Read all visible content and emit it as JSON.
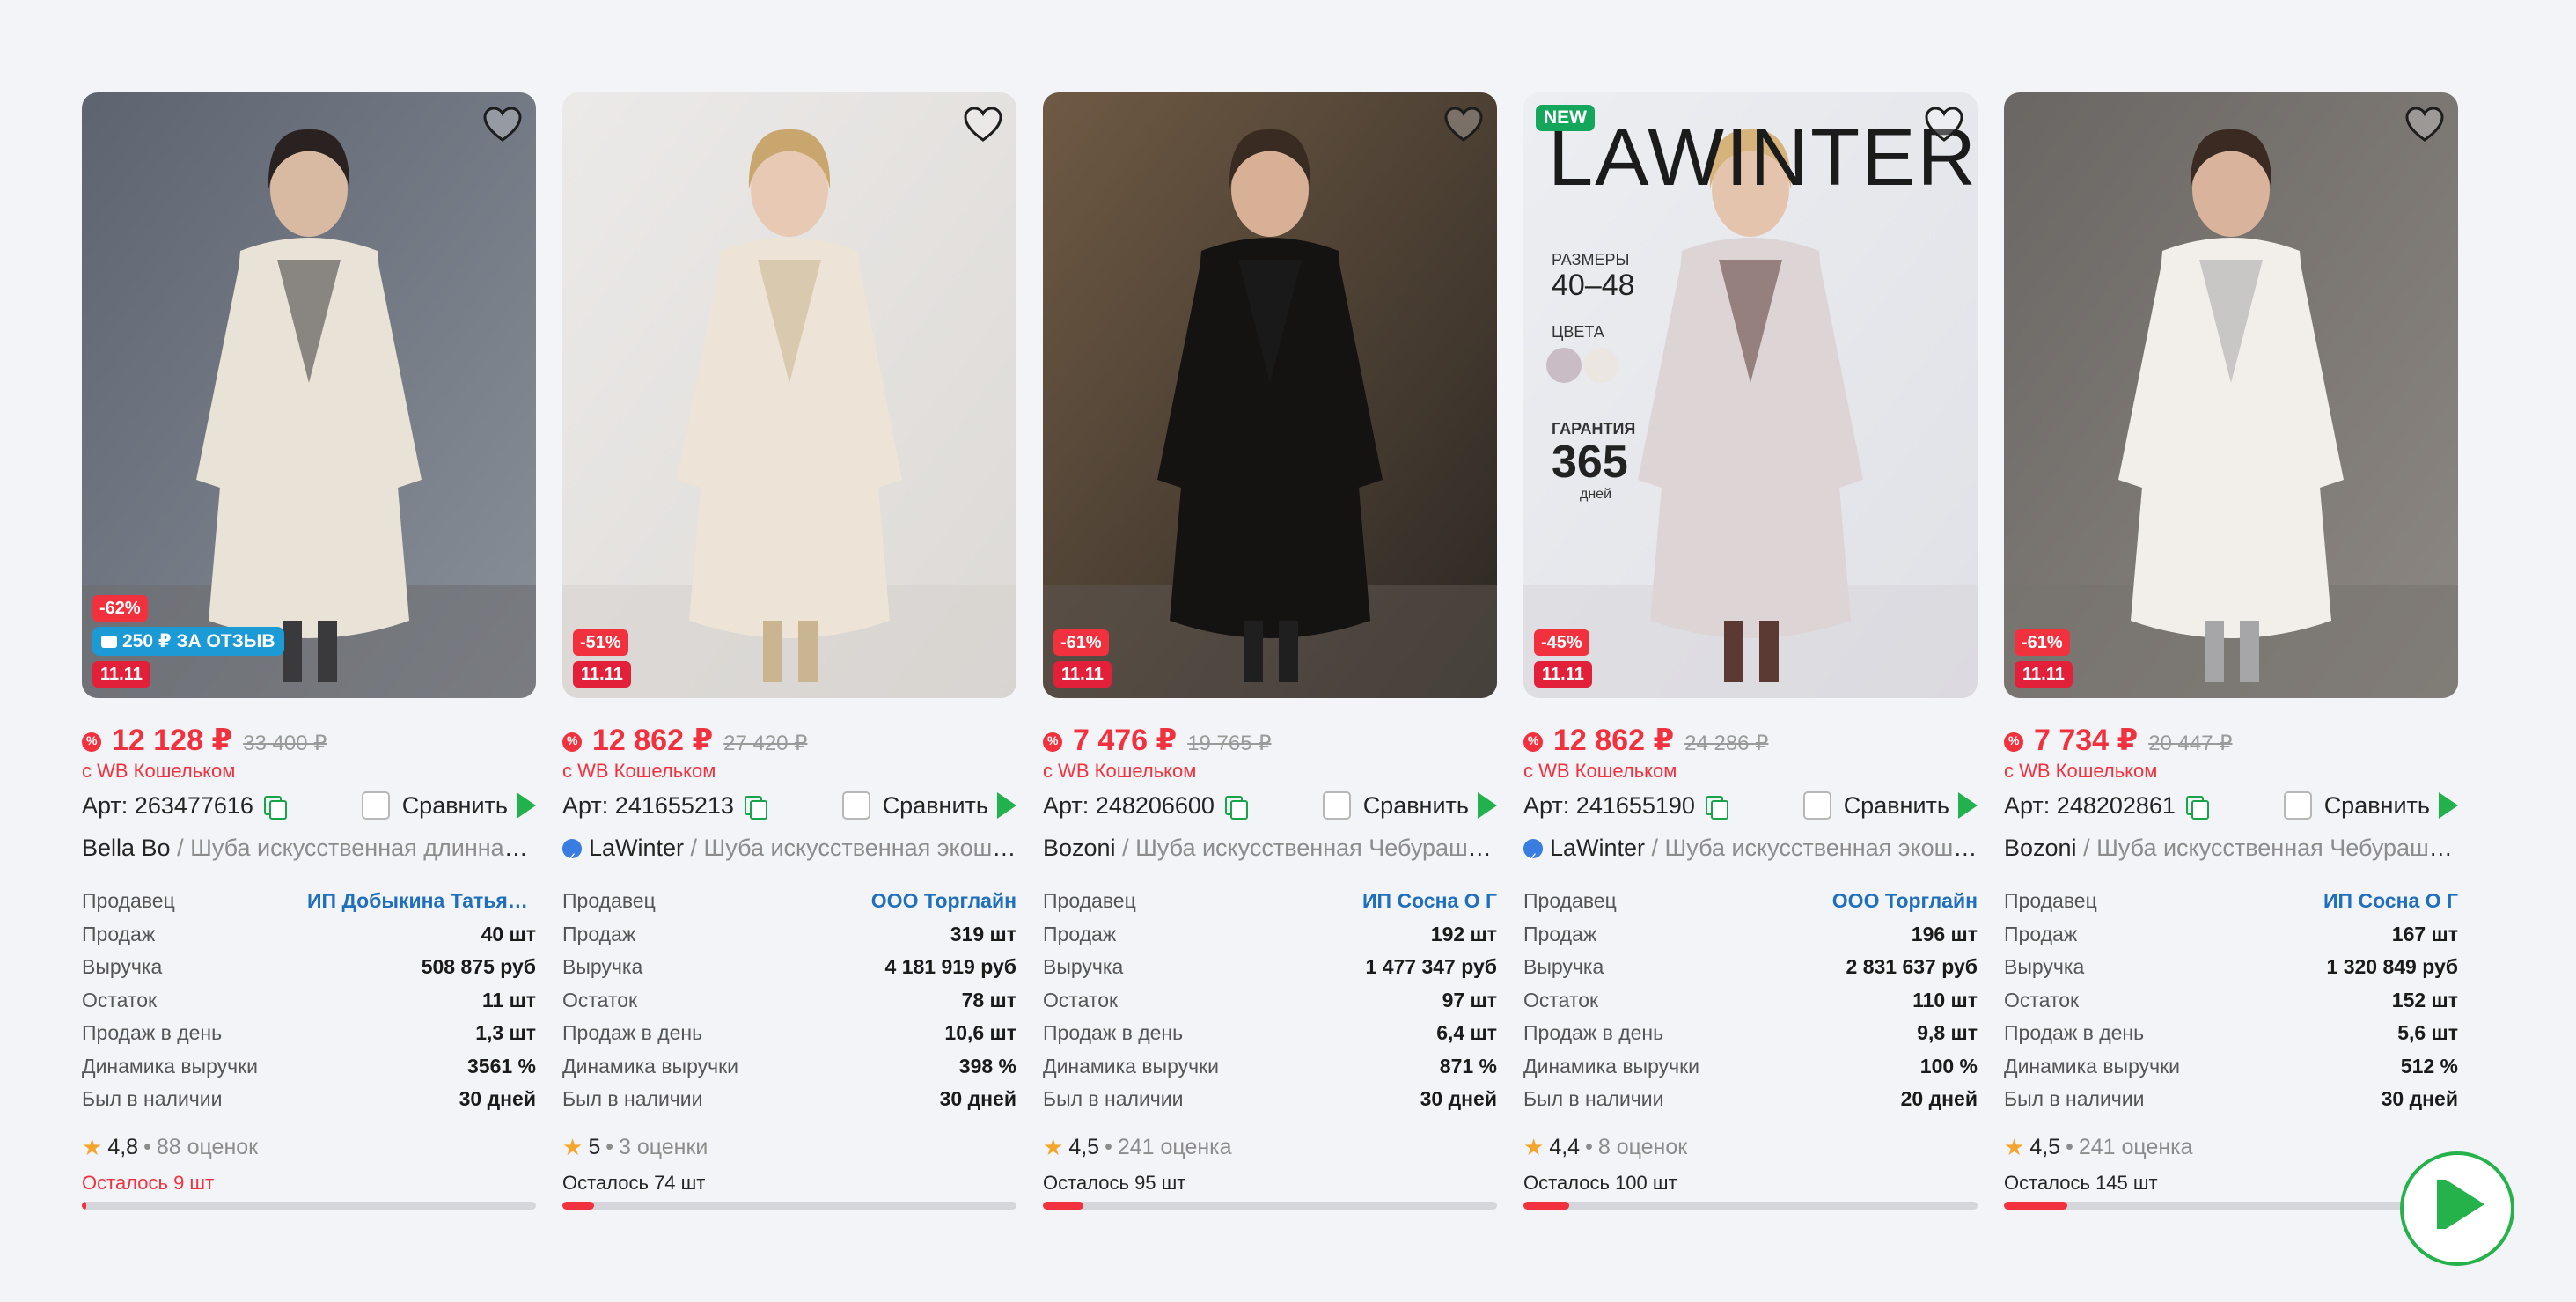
{
  "currency": "₽",
  "labels": {
    "wallet": "с WB Кошельком",
    "compare": "Сравнить",
    "art_prefix": "Арт: ",
    "seller": "Продавец",
    "sales": "Продаж",
    "revenue": "Выручка",
    "stock": "Остаток",
    "sales_per_day": "Продаж в день",
    "revenue_dynamics": "Динамика выручки",
    "in_stock_days": "Был в наличии"
  },
  "products": [
    {
      "photo_theme": "light-coat-city",
      "discount": "-62%",
      "review_badge": "250 ₽ ЗА ОТЗЫВ",
      "sale_badge": "11.11",
      "price": "12 128 ₽",
      "old_price": "33 400 ₽",
      "art": "Арт: 263477616",
      "brand": "Bella Bo",
      "verified": false,
      "name": " / Шуба искусственная длинная з...",
      "seller": "ИП Добыкина Татьяна ...",
      "sales": "40 шт",
      "revenue": "508 875 руб",
      "stock": "11 шт",
      "sales_per_day": "1,3 шт",
      "revenue_dynamics": "3561 %",
      "in_stock_days": "30 дней",
      "rating": "4,8",
      "reviews": "88 оценок",
      "left": "Осталось 9 шт",
      "left_low": true,
      "left_fraction": 0.01
    },
    {
      "photo_theme": "cream-coat-studio",
      "discount": "-51%",
      "sale_badge": "11.11",
      "price": "12 862 ₽",
      "old_price": "27 420 ₽",
      "art": "Арт: 241655213",
      "brand": "LaWinter",
      "verified": true,
      "name": " / Шуба искусственная экошу...",
      "seller": "ООО Торглайн",
      "sales": "319 шт",
      "revenue": "4 181 919 руб",
      "stock": "78 шт",
      "sales_per_day": "10,6 шт",
      "revenue_dynamics": "398 %",
      "in_stock_days": "30 дней",
      "rating": "5",
      "reviews": "3 оценки",
      "left": "Осталось 74 шт",
      "left_low": false,
      "left_fraction": 0.07
    },
    {
      "photo_theme": "black-coat-street",
      "discount": "-61%",
      "sale_badge": "11.11",
      "price": "7 476 ₽",
      "old_price": "19 765 ₽",
      "art": "Арт: 248206600",
      "brand": "Bozoni",
      "verified": false,
      "name": " / Шуба искусственная Чебурашка...",
      "seller": "ИП Сосна О Г",
      "sales": "192 шт",
      "revenue": "1 477 347 руб",
      "stock": "97 шт",
      "sales_per_day": "6,4 шт",
      "revenue_dynamics": "871 %",
      "in_stock_days": "30 дней",
      "rating": "4,5",
      "reviews": "241 оценка",
      "left": "Осталось 95 шт",
      "left_low": false,
      "left_fraction": 0.09
    },
    {
      "photo_theme": "lilac-coat-promo",
      "new_badge": "NEW",
      "promo": {
        "brand": "LAWINTER",
        "sizes_label": "РАЗМЕРЫ",
        "sizes": "40–48",
        "colors_label": "ЦВЕТА",
        "guarantee_label": "ГАРАНТИЯ",
        "guarantee_value": "365",
        "guarantee_unit": "дней"
      },
      "discount": "-45%",
      "sale_badge": "11.11",
      "price": "12 862 ₽",
      "old_price": "24 286 ₽",
      "art": "Арт: 241655190",
      "brand": "LaWinter",
      "verified": true,
      "name": " / Шуба искусственная экошу...",
      "seller": "ООО Торглайн",
      "sales": "196 шт",
      "revenue": "2 831 637 руб",
      "stock": "110 шт",
      "sales_per_day": "9,8 шт",
      "revenue_dynamics": "100 %",
      "in_stock_days": "20 дней",
      "rating": "4,4",
      "reviews": "8 оценок",
      "left": "Осталось 100 шт",
      "left_low": false,
      "left_fraction": 0.1
    },
    {
      "photo_theme": "white-coat-coffee",
      "discount": "-61%",
      "sale_badge": "11.11",
      "price": "7 734 ₽",
      "old_price": "20 447 ₽",
      "art": "Арт: 248202861",
      "brand": "Bozoni",
      "verified": false,
      "name": " / Шуба искусственная Чебурашка...",
      "seller": "ИП Сосна О Г",
      "sales": "167 шт",
      "revenue": "1 320 849 руб",
      "stock": "152 шт",
      "sales_per_day": "5,6 шт",
      "revenue_dynamics": "512 %",
      "in_stock_days": "30 дней",
      "rating": "4,5",
      "reviews": "241 оценка",
      "left": "Осталось 145 шт",
      "left_low": false,
      "left_fraction": 0.14
    }
  ],
  "colors": {
    "price_red": "#f1323e",
    "seller_blue": "#1f6fbd",
    "accent_green": "#22b14c",
    "review_blue": "#1c9ad6"
  }
}
